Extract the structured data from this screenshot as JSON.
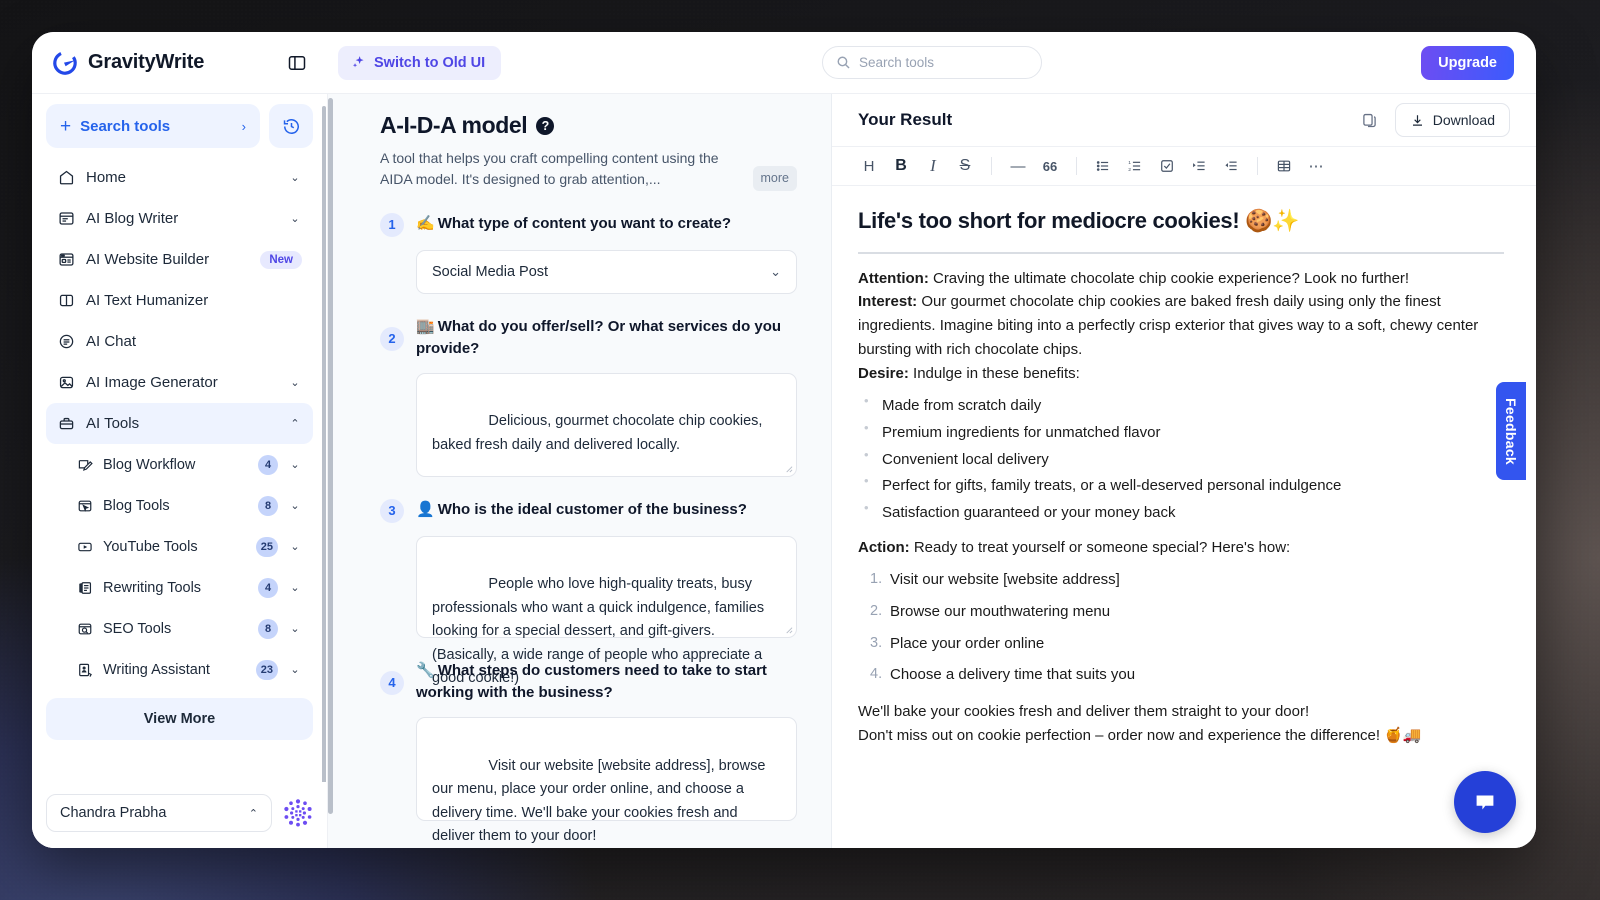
{
  "brand": {
    "name": "GravityWrite"
  },
  "topbar": {
    "switch_label": "Switch to Old UI",
    "search_placeholder": "Search tools",
    "search_value": "",
    "upgrade_label": "Upgrade"
  },
  "sidebar": {
    "search_tools_label": "Search tools",
    "nav": [
      {
        "label": "Home",
        "icon": "home-icon",
        "chevron": "⌄",
        "badge": ""
      },
      {
        "label": "AI Blog Writer",
        "icon": "article-icon",
        "chevron": "⌄",
        "badge": ""
      },
      {
        "label": "AI Website Builder",
        "icon": "browser-icon",
        "chevron": "",
        "badge": "New"
      },
      {
        "label": "AI Text Humanizer",
        "icon": "book-icon",
        "chevron": "",
        "badge": ""
      },
      {
        "label": "AI Chat",
        "icon": "chat-circle-icon",
        "chevron": "",
        "badge": ""
      },
      {
        "label": "AI Image Generator",
        "icon": "image-icon",
        "chevron": "⌄",
        "badge": ""
      },
      {
        "label": "AI Tools",
        "icon": "toolbox-icon",
        "chevron": "⌃",
        "badge": "",
        "active": true
      }
    ],
    "sub_items": [
      {
        "label": "Blog Workflow",
        "count": "4",
        "icon": "pencil-square-icon"
      },
      {
        "label": "Blog Tools",
        "count": "8",
        "icon": "cursor-window-icon"
      },
      {
        "label": "YouTube Tools",
        "count": "25",
        "icon": "play-rect-icon"
      },
      {
        "label": "Rewriting Tools",
        "count": "4",
        "icon": "rewrite-icon"
      },
      {
        "label": "SEO Tools",
        "count": "8",
        "icon": "seo-search-icon"
      },
      {
        "label": "Writing Assistant",
        "count": "23",
        "icon": "assistant-icon"
      }
    ],
    "view_more_label": "View More",
    "user_name": "Chandra Prabha"
  },
  "form": {
    "title": "A-I-D-A model",
    "description": "A tool that helps you craft compelling content using the AIDA model. It's designed to grab attention,...",
    "more_label": "more",
    "questions": [
      {
        "number": "1",
        "emoji": "✍️",
        "label": "What type of content you want to create?",
        "type": "select",
        "value": "Social Media Post"
      },
      {
        "number": "2",
        "emoji": "🏬",
        "label": "What do you offer/sell? Or what services do you provide?",
        "type": "textarea",
        "value": "Delicious, gourmet chocolate chip cookies, baked fresh daily and delivered locally."
      },
      {
        "number": "3",
        "emoji": "👤",
        "label": "Who is the ideal customer of the business?",
        "type": "textarea",
        "value": "People who love high-quality treats, busy professionals who want a quick indulgence, families looking for a special dessert, and gift-givers. (Basically, a wide range of people who appreciate a good cookie!)"
      },
      {
        "number": "4",
        "emoji": "🔧",
        "label": "What steps do customers need to take to start working with the business?",
        "type": "textarea",
        "value": "Visit our website [website address], browse our menu, place your order online, and choose a delivery time. We'll bake your cookies fresh and deliver them to your door!"
      }
    ]
  },
  "result": {
    "title": "Your Result",
    "download_label": "Download",
    "toolbar": [
      {
        "name": "heading",
        "glyph": "H"
      },
      {
        "name": "bold",
        "glyph": "B"
      },
      {
        "name": "italic",
        "glyph": "I"
      },
      {
        "name": "strikethrough",
        "glyph": "S"
      },
      {
        "name": "horizontal-rule",
        "glyph": "—"
      },
      {
        "name": "blockquote",
        "glyph": "66"
      },
      {
        "name": "bulleted-list",
        "glyph": ""
      },
      {
        "name": "numbered-list",
        "glyph": ""
      },
      {
        "name": "checklist",
        "glyph": ""
      },
      {
        "name": "indent-increase",
        "glyph": ""
      },
      {
        "name": "indent-decrease",
        "glyph": ""
      },
      {
        "name": "table",
        "glyph": ""
      },
      {
        "name": "more-options",
        "glyph": "⋯"
      }
    ],
    "heading": "Life's too short for mediocre cookies! 🍪✨",
    "attention_label": "Attention:",
    "attention_text": " Craving the ultimate chocolate chip cookie experience? Look no further!",
    "interest_label": "Interest:",
    "interest_text": " Our gourmet chocolate chip cookies are baked fresh daily using only the finest ingredients. Imagine biting into a perfectly crisp exterior that gives way to a soft, chewy center bursting with rich chocolate chips.",
    "desire_label": "Desire:",
    "desire_text": " Indulge in these benefits:",
    "benefits": [
      "Made from scratch daily",
      "Premium ingredients for unmatched flavor",
      "Convenient local delivery",
      "Perfect for gifts, family treats, or a well-deserved personal indulgence",
      "Satisfaction guaranteed or your money back"
    ],
    "action_label": "Action:",
    "action_text": " Ready to treat yourself or someone special? Here's how:",
    "steps": [
      "Visit our website [website address]",
      "Browse our mouthwatering menu",
      "Place your order online",
      "Choose a delivery time that suits you"
    ],
    "closing_1": "We'll bake your cookies fresh and deliver them straight to your door!",
    "closing_2": "Don't miss out on cookie perfection – order now and experience the difference! 🍯🚚"
  },
  "overlays": {
    "feedback_label": "Feedback"
  },
  "colors": {
    "accent_blue": "#2563eb",
    "upgrade_gradient_start": "#6d4df2",
    "upgrade_gradient_end": "#3b5bfd",
    "feedback_blue": "#3355ef",
    "chat_blue": "#2540d8",
    "soft_blue_bg": "#eef3ff",
    "count_pill": "#c5d4fb"
  }
}
